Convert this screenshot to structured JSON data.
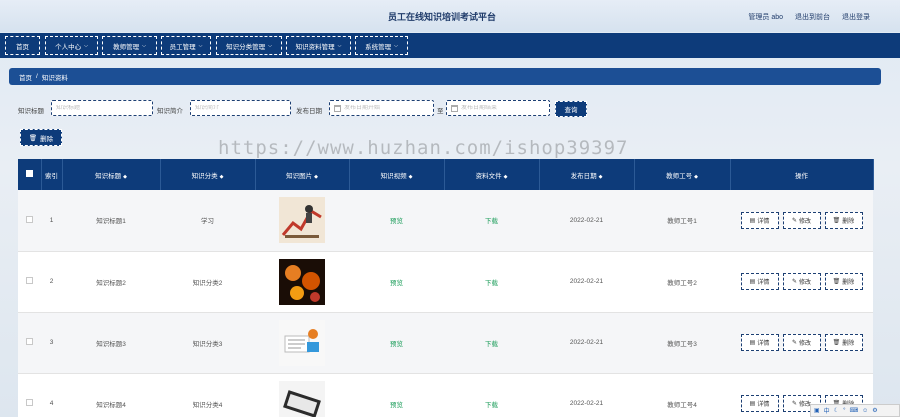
{
  "header": {
    "title": "员工在线知识培训考试平台",
    "links": [
      "管理员 abo",
      "退出到前台",
      "退出登录"
    ]
  },
  "nav": [
    {
      "label": "首页",
      "has_menu": false
    },
    {
      "label": "个人中心",
      "has_menu": true
    },
    {
      "label": "教师管理",
      "has_menu": true
    },
    {
      "label": "员工管理",
      "has_menu": true
    },
    {
      "label": "知识分类管理",
      "has_menu": true
    },
    {
      "label": "知识资料管理",
      "has_menu": true
    },
    {
      "label": "系统管理",
      "has_menu": true
    }
  ],
  "breadcrumb": {
    "home": "首页",
    "sep": "/",
    "current": "知识资料"
  },
  "search": {
    "title_label": "知识标题",
    "title_placeholder": "知识标题",
    "intro_label": "知识简介",
    "intro_placeholder": "知识简介",
    "date_label": "发布日期",
    "date_start_placeholder": "发布日期开始",
    "date_to": "至",
    "date_end_placeholder": "发布日期结束",
    "submit_label": "查询"
  },
  "toolbar": {
    "delete_label": "删除"
  },
  "watermark": "https://www.huzhan.com/ishop39397",
  "table": {
    "headers": [
      "索引",
      "知识标题",
      "知识分类",
      "知识图片",
      "知识视频",
      "资料文件",
      "发布日期",
      "教师工号",
      "操作"
    ],
    "rows": [
      {
        "index": "1",
        "title": "知识标题1",
        "category": "学习",
        "video": "预览",
        "file": "下载",
        "date": "2022-02-21",
        "teacher": "教师工号1"
      },
      {
        "index": "2",
        "title": "知识标题2",
        "category": "知识分类2",
        "video": "预览",
        "file": "下载",
        "date": "2022-02-21",
        "teacher": "教师工号2"
      },
      {
        "index": "3",
        "title": "知识标题3",
        "category": "知识分类3",
        "video": "预览",
        "file": "下载",
        "date": "2022-02-21",
        "teacher": "教师工号3"
      },
      {
        "index": "4",
        "title": "知识标题4",
        "category": "知识分类4",
        "video": "预览",
        "file": "下载",
        "date": "2022-02-21",
        "teacher": "教师工号4"
      }
    ],
    "actions": {
      "detail": "详情",
      "edit": "修改",
      "delete": "删除"
    }
  },
  "tray": {
    "ime": "中"
  },
  "colors": {
    "navy": "#0d3b7a",
    "breadcrumb": "#1c4f95",
    "link_green": "#1e9e5c"
  }
}
